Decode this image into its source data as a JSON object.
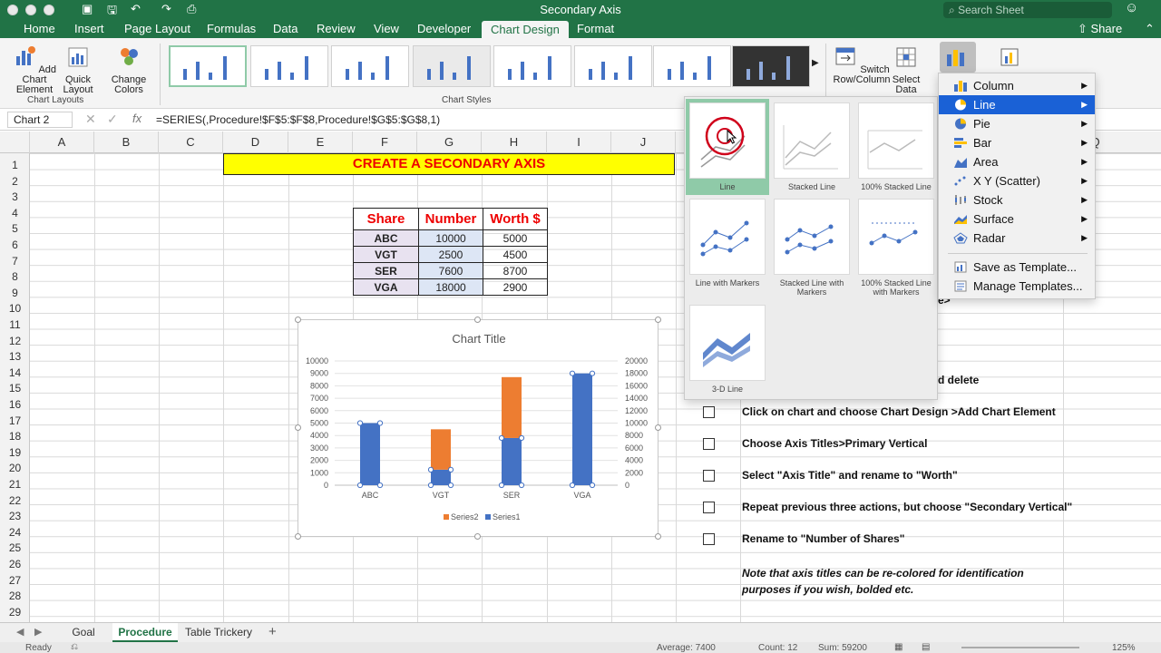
{
  "window": {
    "title": "Secondary Axis",
    "search_placeholder": "Search Sheet",
    "share": "Share"
  },
  "tabs": [
    "Home",
    "Insert",
    "Page Layout",
    "Formulas",
    "Data",
    "Review",
    "View",
    "Developer",
    "Chart Design",
    "Format"
  ],
  "ribbon": {
    "add_chart_element": "Add Chart Element",
    "quick_layout": "Quick Layout",
    "change_colors": "Change Colors",
    "chart_layouts": "Chart Layouts",
    "chart_styles": "Chart Styles",
    "switch_row_column": "Switch Row/Column",
    "select_data": "Select Data"
  },
  "formula_bar": {
    "name_box": "Chart 2",
    "formula": "=SERIES(,Procedure!$F$5:$F$8,Procedure!$G$5:$G$8,1)"
  },
  "columns": [
    "A",
    "B",
    "C",
    "D",
    "E",
    "F",
    "G",
    "H",
    "I",
    "J",
    "Q"
  ],
  "rows": [
    "1",
    "2",
    "3",
    "4",
    "5",
    "6",
    "7",
    "8",
    "9",
    "10",
    "11",
    "12",
    "13",
    "14",
    "15",
    "16",
    "17",
    "18",
    "19",
    "20",
    "21",
    "22",
    "23",
    "24",
    "25",
    "26",
    "27",
    "28",
    "29"
  ],
  "banner": "CREATE A SECONDARY AXIS",
  "table": {
    "headers": [
      "Share",
      "Number",
      "Worth $"
    ],
    "rows": [
      [
        "ABC",
        "10000",
        "5000"
      ],
      [
        "VGT",
        "2500",
        "4500"
      ],
      [
        "SER",
        "7600",
        "8700"
      ],
      [
        "VGA",
        "18000",
        "2900"
      ]
    ]
  },
  "chart_data": {
    "type": "bar",
    "title": "Chart Title",
    "categories": [
      "ABC",
      "VGT",
      "SER",
      "VGA"
    ],
    "series": [
      {
        "name": "Series1",
        "values": [
          5000,
          1250,
          3800,
          9000
        ],
        "color": "#4472c4"
      },
      {
        "name": "Series2",
        "values": [
          0,
          3250,
          4900,
          0
        ],
        "color": "#ed7d31"
      }
    ],
    "ylim": [
      0,
      10000
    ],
    "y_ticks": [
      "10000",
      "9000",
      "8000",
      "7000",
      "6000",
      "5000",
      "4000",
      "3000",
      "2000",
      "1000",
      "0"
    ],
    "y2_ticks": [
      "20000",
      "18000",
      "16000",
      "14000",
      "12000",
      "10000",
      "8000",
      "6000",
      "4000",
      "2000",
      "0"
    ],
    "legend": "bottom"
  },
  "instructions": [
    {
      "text": "Click on chart and choose Chart Design >Add Chart Element",
      "checkbox": true
    },
    {
      "text": "Choose Axis Titles>Primary Vertical",
      "checkbox": true
    },
    {
      "text": "Select \"Axis Title\" and rename to \"Worth\"",
      "checkbox": true
    },
    {
      "text": "Repeat previous three actions, but choose \"Secondary Vertical\"",
      "checkbox": true
    },
    {
      "text": "Rename to \"Number of Shares\"",
      "checkbox": true
    }
  ],
  "partial_texts": {
    "row9": "e>",
    "row14": "d delete"
  },
  "note": "Note that axis titles can be re-colored for identification purposes if you wish, bolded etc.",
  "gallery": [
    "Line",
    "Stacked Line",
    "100% Stacked Line",
    "Line with Markers",
    "Stacked Line with Markers",
    "100% Stacked Line with Markers",
    "3-D Line"
  ],
  "menu": {
    "items": [
      "Column",
      "Line",
      "Pie",
      "Bar",
      "Area",
      "X Y (Scatter)",
      "Stock",
      "Surface",
      "Radar"
    ],
    "selected": "Line",
    "actions": [
      "Save as Template...",
      "Manage Templates..."
    ]
  },
  "sheets": [
    "Goal",
    "Procedure",
    "Table Trickery"
  ],
  "active_sheet": "Procedure",
  "status": {
    "ready": "Ready",
    "average": "Average: 7400",
    "count": "Count: 12",
    "sum": "Sum: 59200",
    "zoom": "125%"
  }
}
